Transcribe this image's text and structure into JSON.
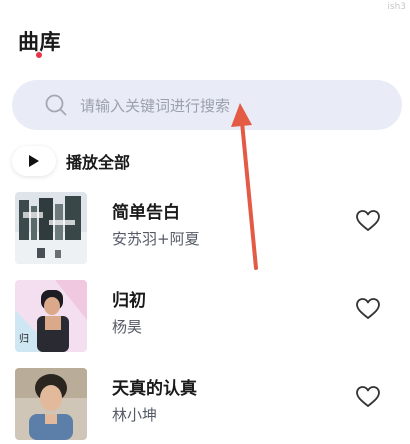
{
  "header": {
    "title": "曲库",
    "indicator_color": "#e8344a"
  },
  "watermark": "ish3",
  "search": {
    "placeholder": "请输入关键词进行搜索",
    "icon": "search-icon"
  },
  "play_all": {
    "label": "播放全部",
    "icon": "play-icon"
  },
  "songs": [
    {
      "title": "简单告白",
      "artist": "安苏羽+阿夏",
      "like_icon": "heart-outline-icon"
    },
    {
      "title": "归初",
      "artist": "杨昊",
      "like_icon": "heart-outline-icon"
    },
    {
      "title": "天真的认真",
      "artist": "林小坤",
      "like_icon": "heart-outline-icon"
    }
  ],
  "colors": {
    "accent": "#e8344a",
    "search_bg": "#e9ecf6",
    "annotation": "#e35a45"
  }
}
